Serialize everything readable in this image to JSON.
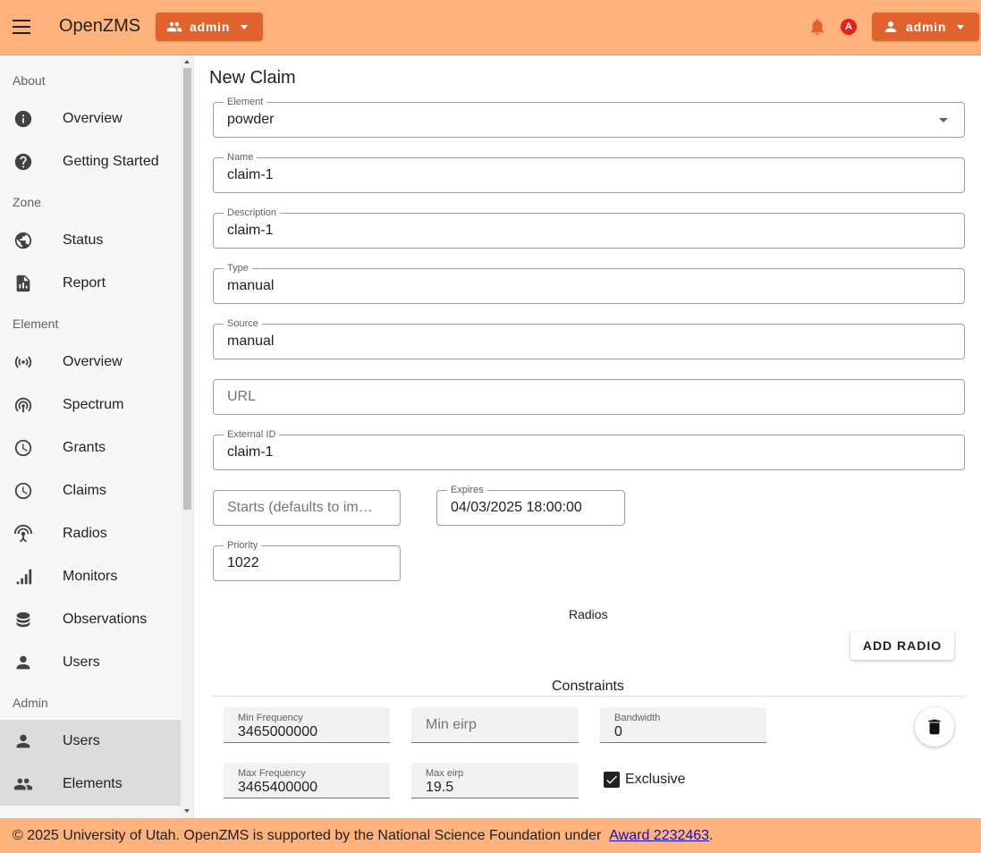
{
  "header": {
    "title": "OpenZMS",
    "zone_button": "admin",
    "user_button": "admin",
    "badge_letter": "A"
  },
  "sidebar": {
    "sections": {
      "about": "About",
      "zone": "Zone",
      "element": "Element",
      "admin": "Admin"
    },
    "items": {
      "overview_about": {
        "label": "Overview",
        "icon": "info-icon"
      },
      "getting_started": {
        "label": "Getting Started",
        "icon": "help-icon"
      },
      "status": {
        "label": "Status",
        "icon": "globe-icon"
      },
      "report": {
        "label": "Report",
        "icon": "report-icon"
      },
      "overview_element": {
        "label": "Overview",
        "icon": "antenna-icon"
      },
      "spectrum": {
        "label": "Spectrum",
        "icon": "spectrum-icon"
      },
      "grants": {
        "label": "Grants",
        "icon": "clock-icon"
      },
      "claims": {
        "label": "Claims",
        "icon": "clock-icon"
      },
      "radios": {
        "label": "Radios",
        "icon": "radio-tower-icon"
      },
      "monitors": {
        "label": "Monitors",
        "icon": "signal-bars-icon"
      },
      "observations": {
        "label": "Observations",
        "icon": "database-icon"
      },
      "users_element": {
        "label": "Users",
        "icon": "person-icon"
      },
      "users_admin": {
        "label": "Users",
        "icon": "person-icon"
      },
      "elements_admin": {
        "label": "Elements",
        "icon": "group-icon"
      }
    }
  },
  "form": {
    "title": "New Claim",
    "element": {
      "label": "Element",
      "value": "powder"
    },
    "name": {
      "label": "Name",
      "value": "claim-1"
    },
    "description": {
      "label": "Description",
      "value": "claim-1"
    },
    "type": {
      "label": "Type",
      "value": "manual"
    },
    "source": {
      "label": "Source",
      "value": "manual"
    },
    "url": {
      "placeholder": "URL",
      "value": ""
    },
    "external_id": {
      "label": "External ID",
      "value": "claim-1"
    },
    "starts": {
      "placeholder": "Starts (defaults to im…",
      "value": ""
    },
    "expires": {
      "label": "Expires",
      "value": "04/03/2025 18:00:00"
    },
    "priority": {
      "label": "Priority",
      "value": "1022"
    },
    "radios_label": "Radios",
    "add_radio_label": "ADD RADIO",
    "constraints_label": "Constraints",
    "constraint": {
      "min_frequency": {
        "label": "Min Frequency",
        "value": "3465000000"
      },
      "min_eirp": {
        "placeholder": "Min eirp",
        "value": ""
      },
      "bandwidth": {
        "label": "Bandwidth",
        "value": "0"
      },
      "max_frequency": {
        "label": "Max Frequency",
        "value": "3465400000"
      },
      "max_eirp": {
        "label": "Max eirp",
        "value": "19.5"
      },
      "exclusive": {
        "label": "Exclusive",
        "checked": true
      }
    }
  },
  "footer": {
    "text": "© 2025 University of Utah. OpenZMS is supported by the National Science Foundation under ",
    "link": "Award 2232463",
    "suffix": "."
  },
  "colors": {
    "header_bg": "#ffb27b",
    "accent": "#e0622d",
    "badge": "#e8201c"
  }
}
